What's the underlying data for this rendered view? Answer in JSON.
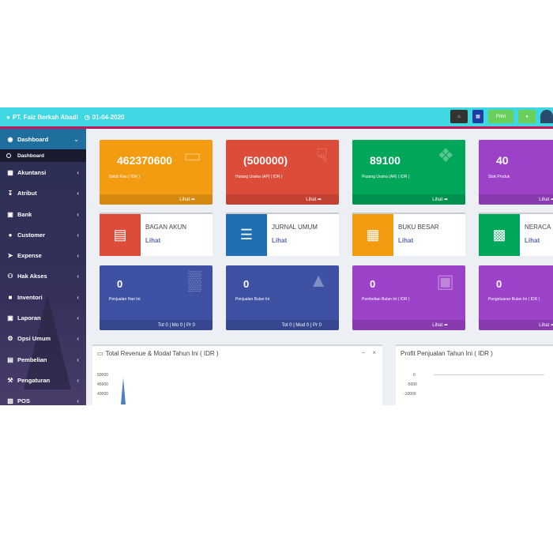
{
  "header": {
    "company": "PT. Faiz Berkah Abadi",
    "date": "01-04-2020",
    "btn_print": "Print",
    "color": "#3fd8e2"
  },
  "sidebar": {
    "items": [
      {
        "label": "Dashboard",
        "icon": "dashboard-icon"
      },
      {
        "label": "Akuntansi",
        "icon": "calculator-icon"
      },
      {
        "label": "Atribut",
        "icon": "download-icon"
      },
      {
        "label": "Bank",
        "icon": "bank-icon"
      },
      {
        "label": "Customer",
        "icon": "user-icon"
      },
      {
        "label": "Expense",
        "icon": "paper-plane-icon"
      },
      {
        "label": "Hak Akses",
        "icon": "users-icon"
      },
      {
        "label": "Inventori",
        "icon": "boxes-icon"
      },
      {
        "label": "Laporan",
        "icon": "chart-icon"
      },
      {
        "label": "Opsi Umum",
        "icon": "gear-icon"
      },
      {
        "label": "Pembelian",
        "icon": "cart-icon"
      },
      {
        "label": "Pengaturan",
        "icon": "wrench-icon"
      },
      {
        "label": "POS",
        "icon": "pos-icon"
      }
    ],
    "sub_dashboard": "Dashboard"
  },
  "cards_row1": [
    {
      "value": "462370600",
      "label": "Saldo Kas ( IDR )",
      "link": "Lihat",
      "color": "#f39c12"
    },
    {
      "value": "(500000)",
      "label": "Hutang Usaha (AP) ( IDR )",
      "link": "Lihat",
      "color": "#dd4b39"
    },
    {
      "value": "89100",
      "label": "Piutang Usaha (AR) ( IDR )",
      "link": "Lihat",
      "color": "#00a65a"
    },
    {
      "value": "40",
      "label": "Stok Produk",
      "link": "Lihat",
      "color": "#9c42c8"
    }
  ],
  "info_boxes": [
    {
      "title": "BAGAN AKUN",
      "link": "Lihat",
      "color": "#dd4b39"
    },
    {
      "title": "JURNAL UMUM",
      "link": "Lihat",
      "color": "#1f6fb2"
    },
    {
      "title": "BUKU BESAR",
      "link": "Lihat",
      "color": "#f39c12"
    },
    {
      "title": "NERACA",
      "link": "Lihat",
      "color": "#00a65a"
    }
  ],
  "cards_row2": [
    {
      "value": "0",
      "label": "Penjualan Hari Ini",
      "footer": "Tot 0 | Mo 0 | Pr 0",
      "color": "#3f51a3"
    },
    {
      "value": "0",
      "label": "Penjualan Bulan Ini",
      "footer": "Tot 0 | Mod 0 | Pr 0",
      "color": "#3f51a3"
    },
    {
      "value": "0",
      "label": "Pembelian Bulan Ini ( IDR )",
      "footer": "Lihat",
      "color": "#9c42c8"
    },
    {
      "value": "0",
      "label": "Pengeluaran Bulan Ini ( IDR )",
      "footer": "Lihat",
      "color": "#9c42c8"
    }
  ],
  "panels": {
    "revenue": {
      "title": "Total Revenue & Modal Tahun Ini ( IDR )",
      "ticks": [
        "50000",
        "45000",
        "40000"
      ]
    },
    "profit": {
      "title": "Profit Penjualan Tahun Ini ( IDR )",
      "ticks": [
        "0",
        "-5000",
        "-10000"
      ]
    }
  }
}
